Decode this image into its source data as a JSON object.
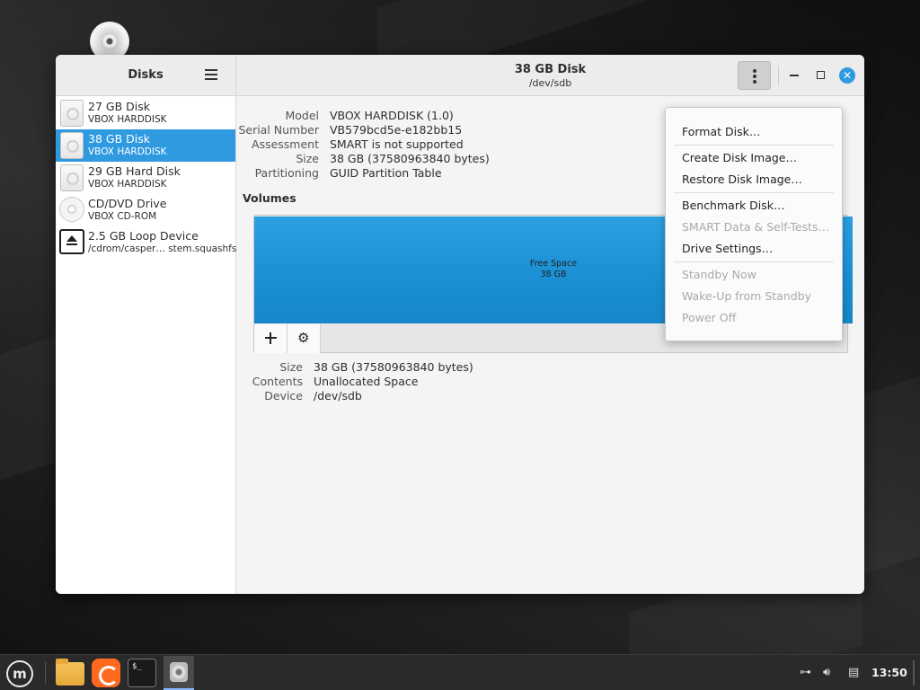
{
  "window": {
    "sidebar_title": "Disks",
    "header_title": "38 GB Disk",
    "header_subtitle": "/dev/sdb"
  },
  "sidebar": {
    "items": [
      {
        "name": "27 GB Disk",
        "sub": "VBOX HARDDISK",
        "icon": "hard-disk-icon",
        "selected": false
      },
      {
        "name": "38 GB Disk",
        "sub": "VBOX HARDDISK",
        "icon": "hard-disk-icon",
        "selected": true
      },
      {
        "name": "29 GB Hard Disk",
        "sub": "VBOX HARDDISK",
        "icon": "hard-disk-icon",
        "selected": false
      },
      {
        "name": "CD/DVD Drive",
        "sub": "VBOX CD-ROM",
        "icon": "cd-drive-icon",
        "selected": false
      },
      {
        "name": "2.5 GB Loop Device",
        "sub": "/cdrom/casper… stem.squashfs",
        "icon": "eject-icon",
        "selected": false
      }
    ]
  },
  "drive_info": {
    "rows": [
      {
        "label": "Model",
        "value": "VBOX HARDDISK (1.0)"
      },
      {
        "label": "Serial Number",
        "value": "VB579bcd5e-e182bb15"
      },
      {
        "label": "Assessment",
        "value": "SMART is not supported"
      },
      {
        "label": "Size",
        "value": "38 GB (37580963840 bytes)"
      },
      {
        "label": "Partitioning",
        "value": "GUID Partition Table"
      }
    ]
  },
  "volumes": {
    "title": "Volumes",
    "partition_name": "Free Space",
    "partition_size": "38 GB",
    "details": [
      {
        "label": "Size",
        "value": "38 GB (37580963840 bytes)"
      },
      {
        "label": "Contents",
        "value": "Unallocated Space"
      },
      {
        "label": "Device",
        "value": "/dev/sdb"
      }
    ]
  },
  "menu": {
    "groups": [
      [
        {
          "label": "Format Disk…",
          "enabled": true
        }
      ],
      [
        {
          "label": "Create Disk Image…",
          "enabled": true
        },
        {
          "label": "Restore Disk Image…",
          "enabled": true
        }
      ],
      [
        {
          "label": "Benchmark Disk…",
          "enabled": true
        },
        {
          "label": "SMART Data & Self-Tests…",
          "enabled": false
        },
        {
          "label": "Drive Settings…",
          "enabled": true
        }
      ],
      [
        {
          "label": "Standby Now",
          "enabled": false
        },
        {
          "label": "Wake-Up from Standby",
          "enabled": false
        },
        {
          "label": "Power Off",
          "enabled": false
        }
      ]
    ]
  },
  "taskbar": {
    "menu_logo": "m",
    "terminal_prompt": "$_",
    "clock": "13:50"
  },
  "colors": {
    "accent": "#2f9ae0",
    "partition": "#1a8fd3",
    "taskbar": "#2a2a2a"
  }
}
